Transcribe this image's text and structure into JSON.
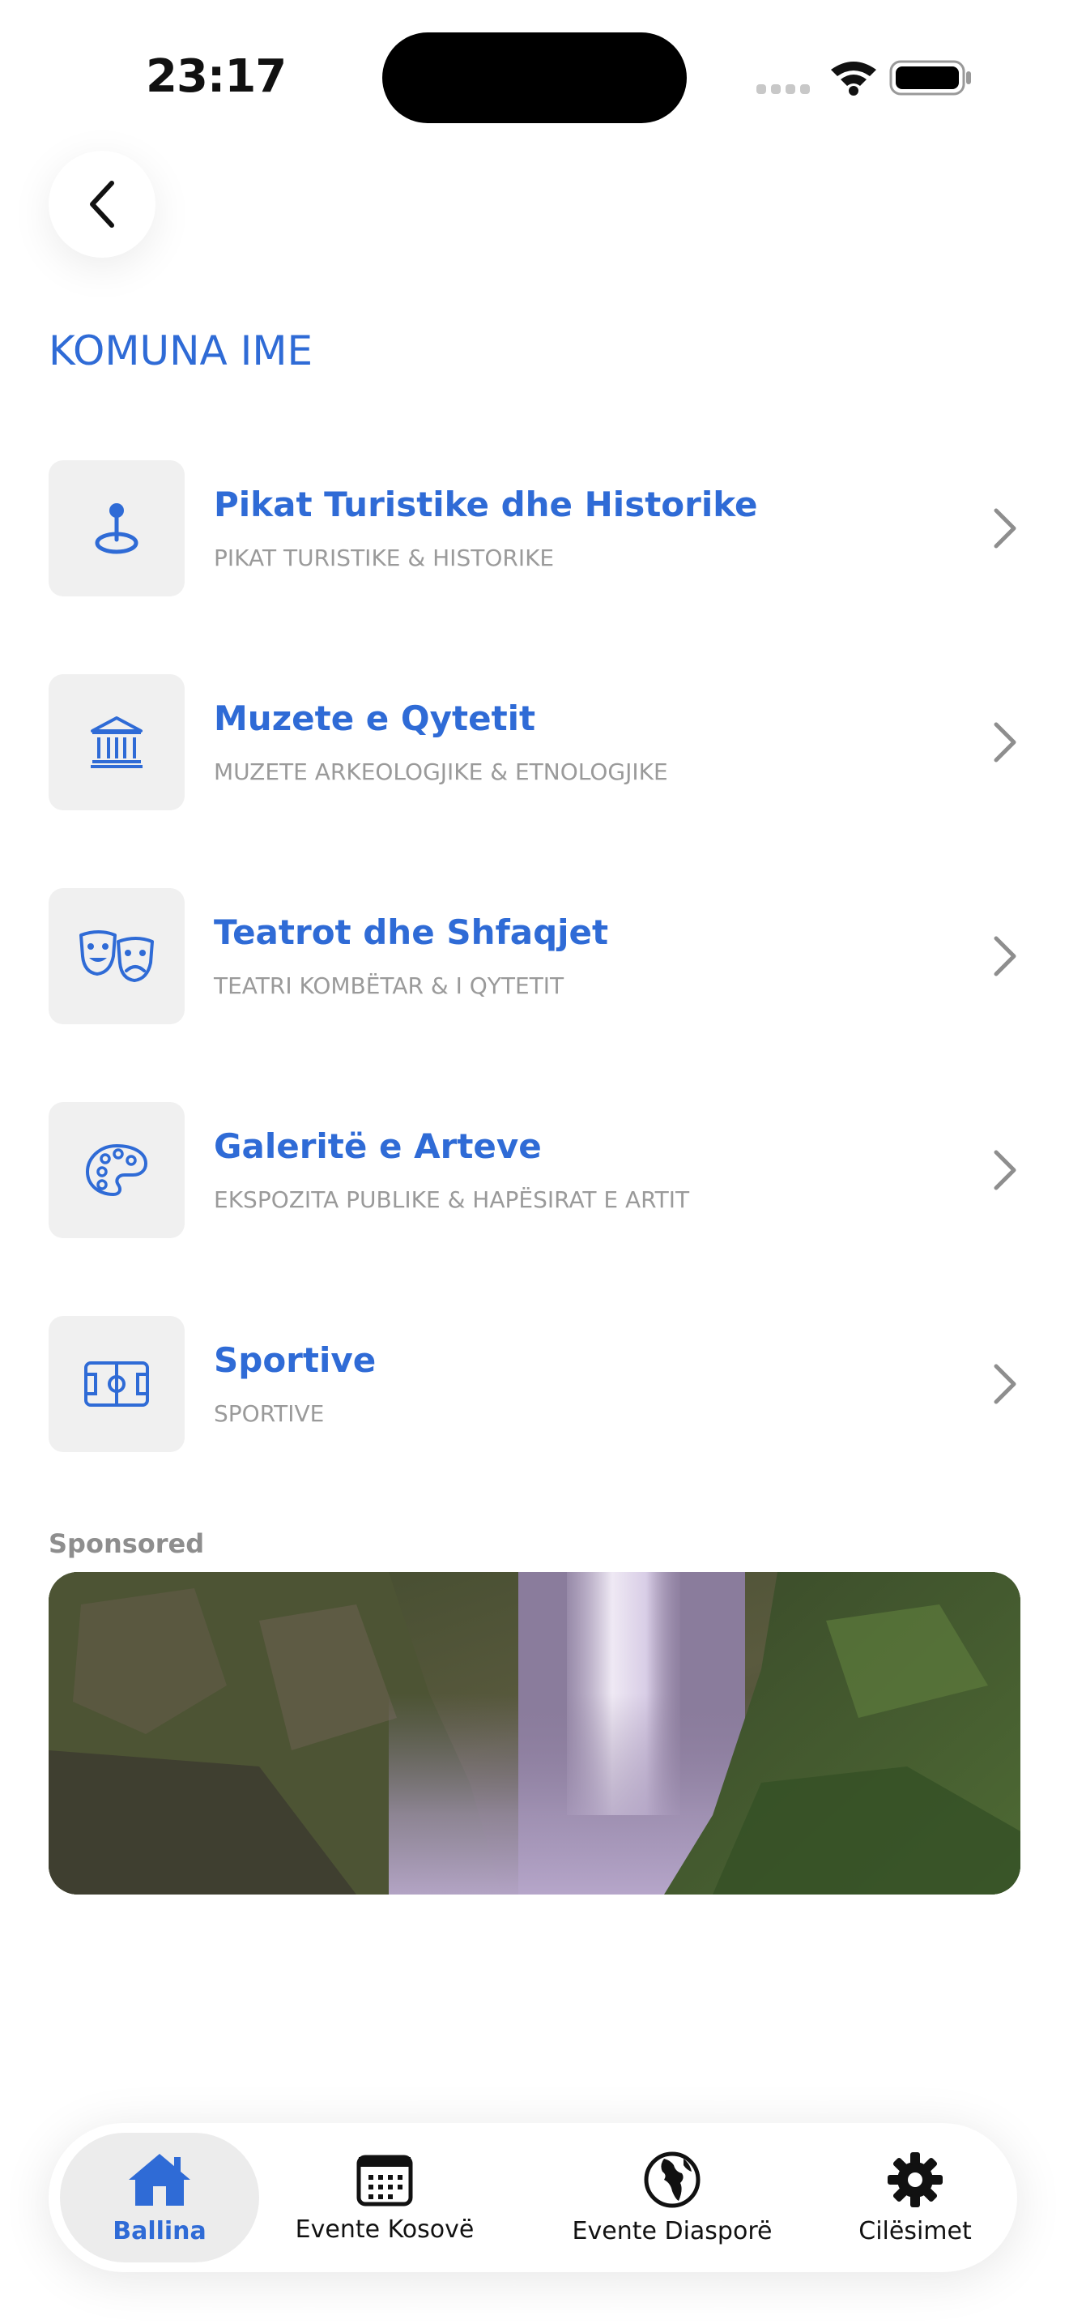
{
  "status_bar": {
    "time": "23:17"
  },
  "page": {
    "title": "KOMUNA IME"
  },
  "list": [
    {
      "title": "Pikat Turistike dhe Historike",
      "subtitle": "PIKAT TURISTIKE & HISTORIKE",
      "icon": "map-pin-icon"
    },
    {
      "title": "Muzete e Qytetit",
      "subtitle": "MUZETE ARKEOLOGJIKE & ETNOLOGJIKE",
      "icon": "museum-icon"
    },
    {
      "title": "Teatrot dhe Shfaqjet",
      "subtitle": "TEATRI KOMBËTAR & I QYTETIT",
      "icon": "theater-masks-icon"
    },
    {
      "title": "Galeritë e Arteve",
      "subtitle": "EKSPOZITA PUBLIKE & HAPËSIRAT E ARTIT",
      "icon": "palette-icon"
    },
    {
      "title": "Sportive",
      "subtitle": "SPORTIVE",
      "icon": "sports-field-icon"
    }
  ],
  "sponsored": {
    "label": "Sponsored"
  },
  "tabbar": {
    "tabs": [
      {
        "label": "Ballina",
        "icon": "home-icon",
        "active": true
      },
      {
        "label": "Evente Kosovë",
        "icon": "calendar-icon",
        "active": false
      },
      {
        "label": "Evente Diasporë",
        "icon": "globe-icon",
        "active": false
      },
      {
        "label": "Cilësimet",
        "icon": "gear-icon",
        "active": false
      }
    ]
  },
  "colors": {
    "accent": "#2f6bd6",
    "subtitle": "#9a9a9a",
    "icon_box": "#f0f0f0"
  }
}
